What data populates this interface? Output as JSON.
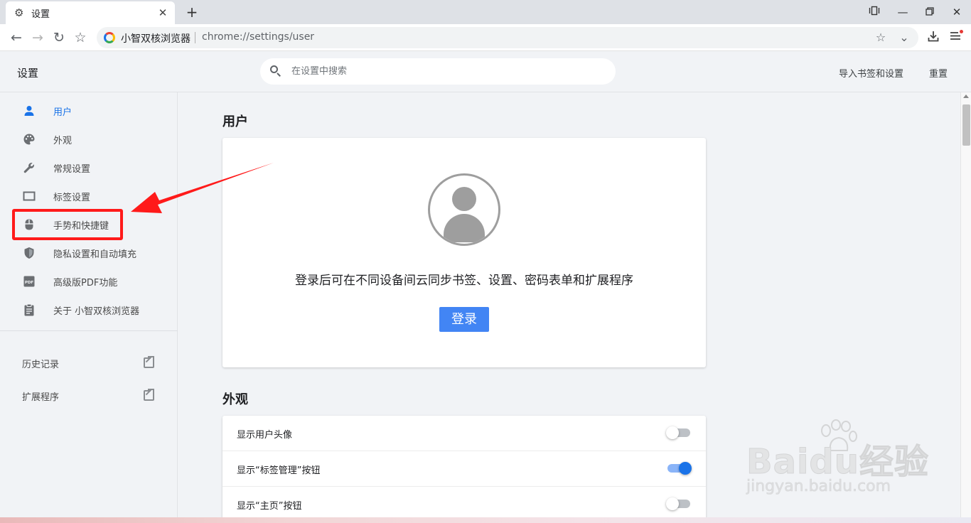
{
  "browser": {
    "tab_title": "设置",
    "site_name": "小智双核浏览器",
    "url": "chrome://settings/user"
  },
  "settings_header": {
    "title": "设置",
    "search_placeholder": "在设置中搜索",
    "import_label": "导入书签和设置",
    "reset_label": "重置"
  },
  "sidebar": {
    "items": [
      {
        "label": "用户",
        "icon": "person-icon",
        "active": true
      },
      {
        "label": "外观",
        "icon": "palette-icon"
      },
      {
        "label": "常规设置",
        "icon": "wrench-icon"
      },
      {
        "label": "标签设置",
        "icon": "tab-icon"
      },
      {
        "label": "手势和快捷键",
        "icon": "mouse-icon"
      },
      {
        "label": "隐私设置和自动填充",
        "icon": "shield-icon"
      },
      {
        "label": "高级版PDF功能",
        "icon": "pdf-icon"
      },
      {
        "label": "关于 小智双核浏览器",
        "icon": "clipboard-icon"
      }
    ],
    "external": [
      {
        "label": "历史记录",
        "icon": "open-in-new-icon"
      },
      {
        "label": "扩展程序",
        "icon": "open-in-new-icon"
      }
    ]
  },
  "main": {
    "user_section": {
      "title": "用户",
      "description": "登录后可在不同设备间云同步书签、设置、密码表单和扩展程序",
      "login_button": "登录"
    },
    "appearance_section": {
      "title": "外观",
      "rows": [
        {
          "label": "显示用户头像",
          "enabled": false
        },
        {
          "label": "显示“标签管理”按钮",
          "enabled": true
        },
        {
          "label": "显示“主页”按钮",
          "enabled": false
        }
      ]
    }
  },
  "watermark": {
    "logo": "Baidu经验",
    "sub": "jingyan.baidu.com"
  },
  "colors": {
    "accent": "#1a73e8",
    "button": "#4285f4",
    "annotation": "#ff1a1a"
  }
}
